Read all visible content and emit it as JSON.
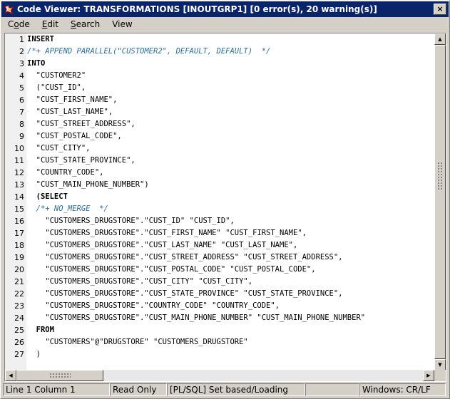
{
  "window": {
    "title": "Code Viewer: TRANSFORMATIONS [INOUTGRP1] [0 error(s), 20 warning(s)]",
    "close_label": "×"
  },
  "menu": [
    {
      "label": "Code",
      "mnemonic": "o"
    },
    {
      "label": "Edit",
      "mnemonic": "E"
    },
    {
      "label": "Search",
      "mnemonic": "S"
    },
    {
      "label": "View",
      "mnemonic": ""
    }
  ],
  "editor": {
    "line_numbers": [
      "1",
      "2",
      "3",
      "4",
      "5",
      "6",
      "7",
      "8",
      "9",
      "10",
      "11",
      "12",
      "13",
      "14",
      "15",
      "16",
      "17",
      "18",
      "19",
      "20",
      "21",
      "22",
      "23",
      "24",
      "25",
      "26",
      "27"
    ],
    "lines": [
      {
        "text": "INSERT",
        "style": "kw"
      },
      {
        "text": "/*+ APPEND PARALLEL(\"CUSTOMER2\", DEFAULT, DEFAULT)  */",
        "style": "cm"
      },
      {
        "text": "INTO",
        "style": "kw"
      },
      {
        "text": "  \"CUSTOMER2\"",
        "style": ""
      },
      {
        "text": "  (\"CUST_ID\",",
        "style": ""
      },
      {
        "text": "  \"CUST_FIRST_NAME\",",
        "style": ""
      },
      {
        "text": "  \"CUST_LAST_NAME\",",
        "style": ""
      },
      {
        "text": "  \"CUST_STREET_ADDRESS\",",
        "style": ""
      },
      {
        "text": "  \"CUST_POSTAL_CODE\",",
        "style": ""
      },
      {
        "text": "  \"CUST_CITY\",",
        "style": ""
      },
      {
        "text": "  \"CUST_STATE_PROVINCE\",",
        "style": ""
      },
      {
        "text": "  \"COUNTRY_CODE\",",
        "style": ""
      },
      {
        "text": "  \"CUST_MAIN_PHONE_NUMBER\")",
        "style": ""
      },
      {
        "text": "  (SELECT",
        "style": "kw"
      },
      {
        "text": "  /*+ NO_MERGE  */",
        "style": "cm"
      },
      {
        "text": "    \"CUSTOMERS_DRUGSTORE\".\"CUST_ID\" \"CUST_ID\",",
        "style": ""
      },
      {
        "text": "    \"CUSTOMERS_DRUGSTORE\".\"CUST_FIRST_NAME\" \"CUST_FIRST_NAME\",",
        "style": ""
      },
      {
        "text": "    \"CUSTOMERS_DRUGSTORE\".\"CUST_LAST_NAME\" \"CUST_LAST_NAME\",",
        "style": ""
      },
      {
        "text": "    \"CUSTOMERS_DRUGSTORE\".\"CUST_STREET_ADDRESS\" \"CUST_STREET_ADDRESS\",",
        "style": ""
      },
      {
        "text": "    \"CUSTOMERS_DRUGSTORE\".\"CUST_POSTAL_CODE\" \"CUST_POSTAL_CODE\",",
        "style": ""
      },
      {
        "text": "    \"CUSTOMERS_DRUGSTORE\".\"CUST_CITY\" \"CUST_CITY\",",
        "style": ""
      },
      {
        "text": "    \"CUSTOMERS_DRUGSTORE\".\"CUST_STATE_PROVINCE\" \"CUST_STATE_PROVINCE\",",
        "style": ""
      },
      {
        "text": "    \"CUSTOMERS_DRUGSTORE\".\"COUNTRY_CODE\" \"COUNTRY_CODE\",",
        "style": ""
      },
      {
        "text": "    \"CUSTOMERS_DRUGSTORE\".\"CUST_MAIN_PHONE_NUMBER\" \"CUST_MAIN_PHONE_NUMBER\"",
        "style": ""
      },
      {
        "text": "  FROM",
        "style": "kw"
      },
      {
        "text": "    \"CUSTOMERS\"@\"DRUGSTORE\" \"CUSTOMERS_DRUGSTORE\"",
        "style": ""
      },
      {
        "text": "  )",
        "style": ""
      }
    ],
    "keyword_color": "#000000",
    "comment_color": "#2f6f9f"
  },
  "scrollbars": {
    "up_arrow": "▲",
    "down_arrow": "▼",
    "left_arrow": "◀",
    "right_arrow": "▶"
  },
  "status": {
    "position": "Line 1 Column 1",
    "mode": "Read Only",
    "language": "[PL/SQL] Set based/Loading",
    "empty": "",
    "line_ending": "Windows: CR/LF"
  },
  "colors": {
    "titlebar": "#0a246a",
    "chrome": "#d4d0c8"
  }
}
